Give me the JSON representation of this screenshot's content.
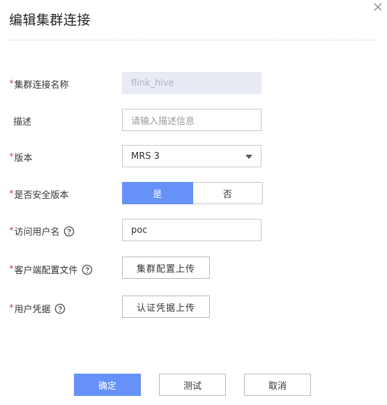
{
  "dialog": {
    "title": "编辑集群连接",
    "close_icon": "close-icon"
  },
  "form": {
    "name": {
      "label": "集群连接名称",
      "required": true,
      "value": "flink_hive"
    },
    "description": {
      "label": "描述",
      "required": false,
      "placeholder": "请输入描述信息",
      "value": ""
    },
    "version": {
      "label": "版本",
      "required": true,
      "value": "MRS 3"
    },
    "secure": {
      "label": "是否安全版本",
      "required": true,
      "options": [
        "是",
        "否"
      ],
      "selected": "是"
    },
    "username": {
      "label": "访问用户名",
      "required": true,
      "value": "poc",
      "help_icon": "question-circle-icon"
    },
    "client_config": {
      "label": "客户端配置文件",
      "required": true,
      "button": "集群配置上传",
      "help_icon": "question-circle-icon"
    },
    "credential": {
      "label": "用户凭据",
      "required": true,
      "button": "认证凭据上传",
      "help_icon": "question-circle-icon"
    }
  },
  "footer": {
    "confirm": "确定",
    "test": "测试",
    "cancel": "取消"
  },
  "colors": {
    "primary": "#6691f8",
    "required": "#e43d3d",
    "disabled_bg": "#e8ebf4"
  }
}
